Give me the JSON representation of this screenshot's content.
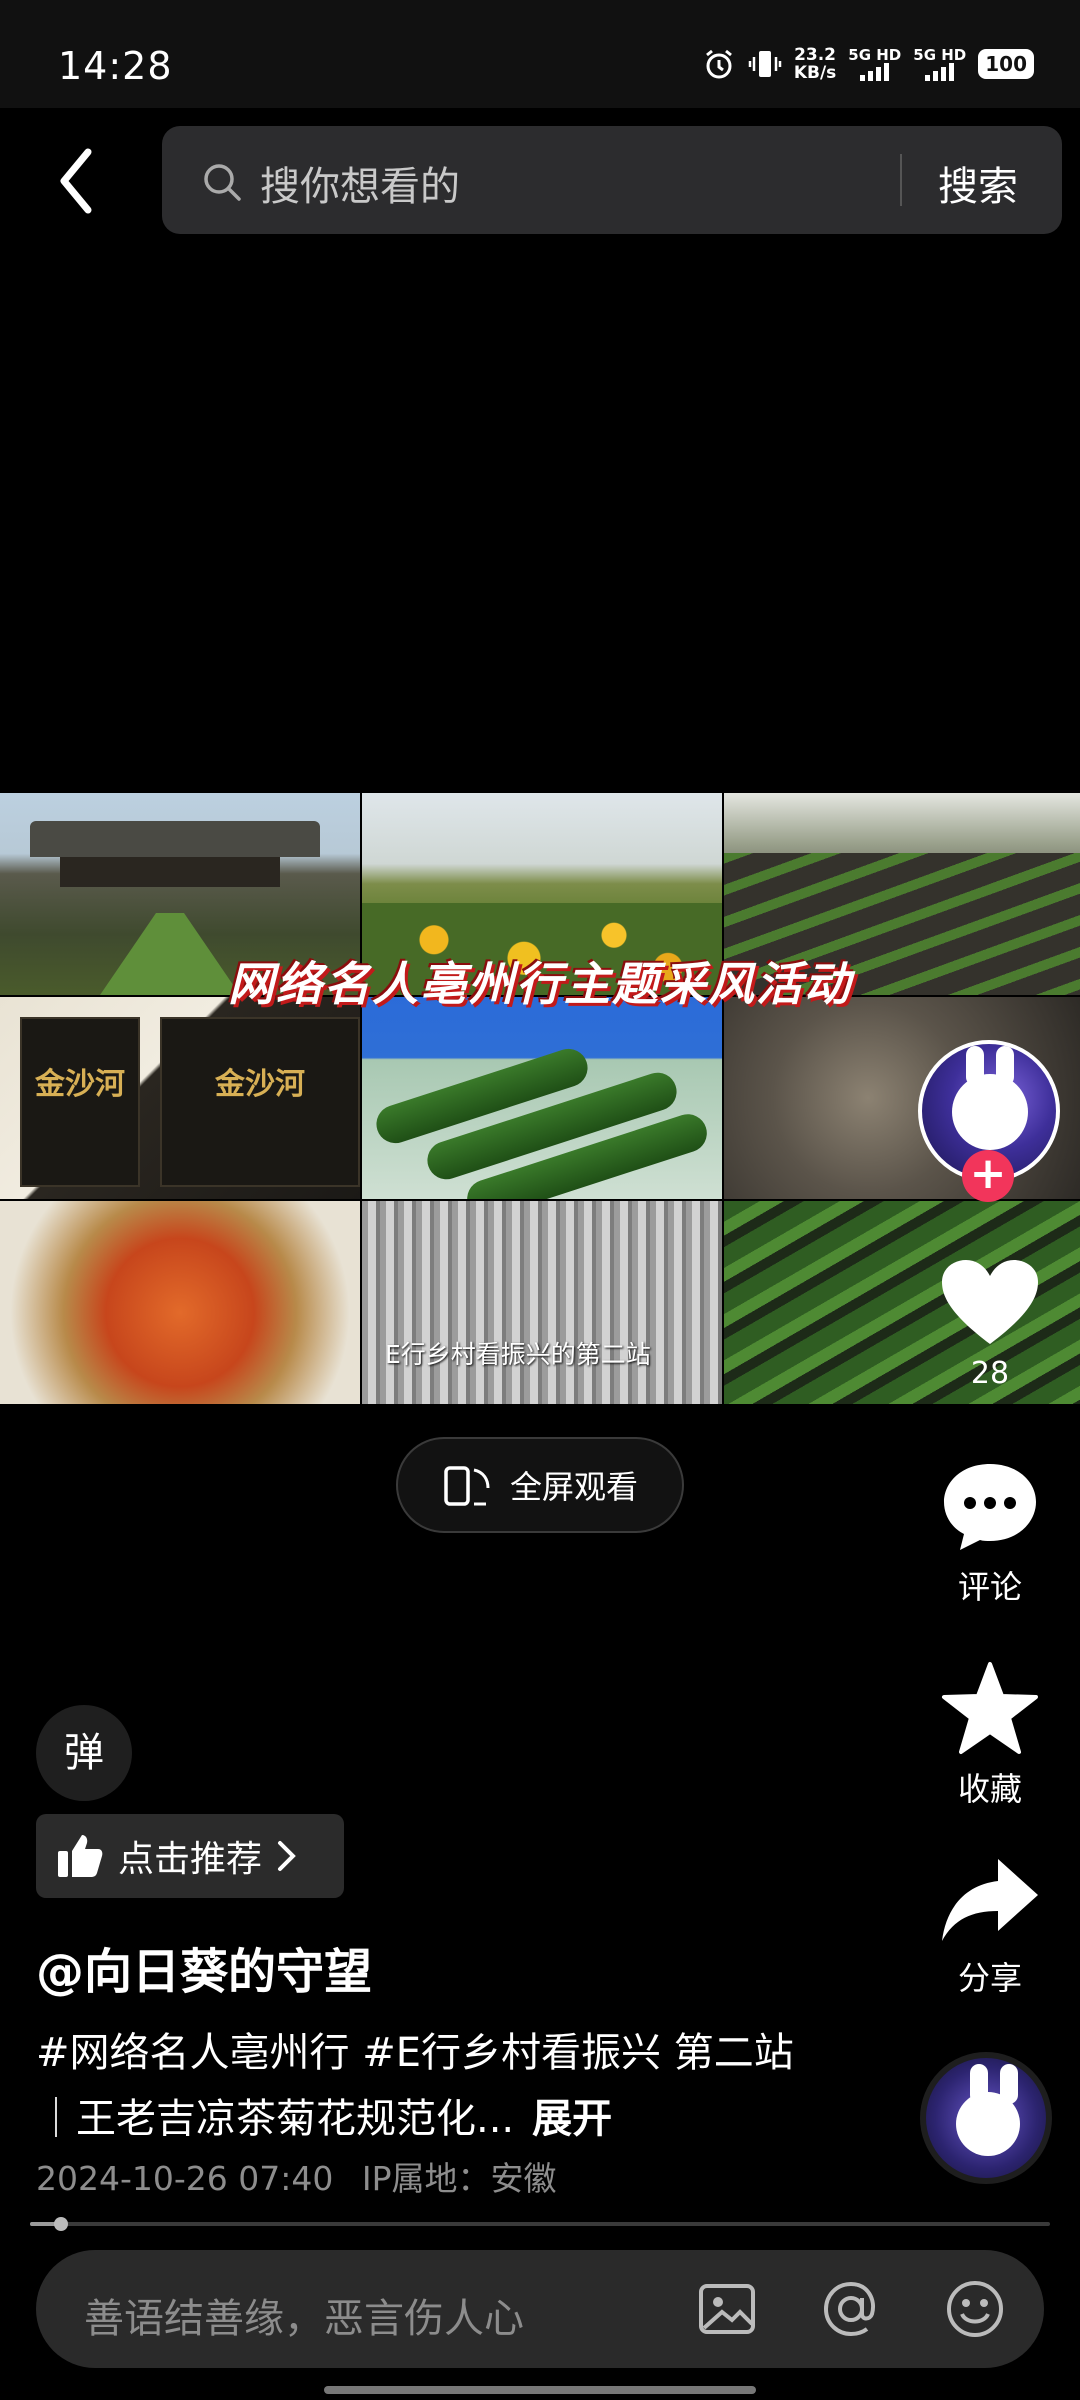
{
  "status_bar": {
    "time": "14:28",
    "net_speed_value": "23.2",
    "net_speed_unit": "KB/s",
    "sim1": "5G HD",
    "sim2": "5G HD",
    "battery": "100",
    "icons": [
      "alarm-icon",
      "vibrate-icon",
      "signal-icon",
      "battery-icon"
    ]
  },
  "header": {
    "search_placeholder": "搜你想看的",
    "search_button": "搜索"
  },
  "video": {
    "overlay_title": "网络名人亳州行主题采风活动",
    "overlay_subtitle": "E行乡村看振兴的第二站",
    "pack_text": "金沙河",
    "fullscreen_label": "全屏观看"
  },
  "rail": {
    "like_count": "28",
    "comment_label": "评论",
    "favorite_label": "收藏",
    "share_label": "分享",
    "follow_symbol": "+"
  },
  "post": {
    "danmaku_label": "弹",
    "recommend_label": "点击推荐",
    "author": "@向日葵的守望",
    "description": "#网络名人亳州行 #E行乡村看振兴 第二站｜王老吉凉茶菊花规范化...",
    "expand_label": "展开",
    "timestamp": "2024-10-26 07:40",
    "ip_location": "IP属地：安徽"
  },
  "playback": {
    "progress_fraction": 0.03
  },
  "comment_bar": {
    "placeholder": "善语结善缘，恶言伤人心",
    "icons": [
      "image-icon",
      "mention-icon",
      "emoji-icon"
    ]
  },
  "colors": {
    "accent_follow": "#f2355b",
    "background": "#000000",
    "searchbox": "#2c2c2e"
  }
}
